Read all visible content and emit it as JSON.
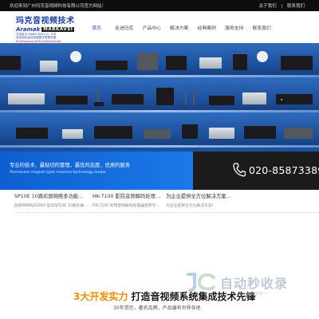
{
  "topbar": {
    "welcome": "欢迎来到广州玛克音视频科技有限公司官方网站！",
    "links": [
      "关于我们",
      "联系我们"
    ],
    "separator": "|"
  },
  "logo": {
    "cn": "玛克音视频技术",
    "en": "Aramak",
    "en_box": "MARKAVSI",
    "brand": "艾玛克®",
    "subline1": "MARK AVS CO., LTD",
    "subline2": "全自动化会议系统数字视音专家",
    "subline3": "Professional AVSI manufacturer"
  },
  "nav": {
    "items": [
      "首页",
      "走进玛克",
      "产品中心",
      "解决方案",
      "经典案例",
      "服务支持",
      "联系我们"
    ],
    "active_index": 0
  },
  "banner": {
    "slogan_cn": "专业的技术、最贴切的管理、最优的态度、优质的服务",
    "slogan_en": "Permanent magnet splat machine technology leader",
    "phone": "020-85873389"
  },
  "news": [
    {
      "title": "SP10E 10路彩屏网络多功能…",
      "desc": "品牌MARKAUDIO 型号SP10E 10路彩屏…"
    },
    {
      "title": "HK-7100 影院音频解码处理…",
      "desc": "HK-7100 影院音频解码处理器音频专…"
    },
    {
      "title": "为企业提供全方位解决方案…",
      "desc": "为企业提供全方位解决方案！"
    },
    {
      "title": "",
      "desc": ""
    }
  ],
  "bottom": {
    "title_highlight": "3大开发实力",
    "title_rest": "打造音视频系统集成技术先锋",
    "desc": "30年资历，著名品牌，产品遍布世界各地"
  },
  "watermark": {
    "text": "自动秒收录",
    "sub": "一 自动秒收录 一"
  },
  "colors": {
    "brand_blue": "#1a3fa5",
    "banner_blue": "#1d4f9a",
    "slogan_blue": "#0e5fd1",
    "phone_bg": "#1b1b1b",
    "highlight_orange": "#f08a00"
  }
}
